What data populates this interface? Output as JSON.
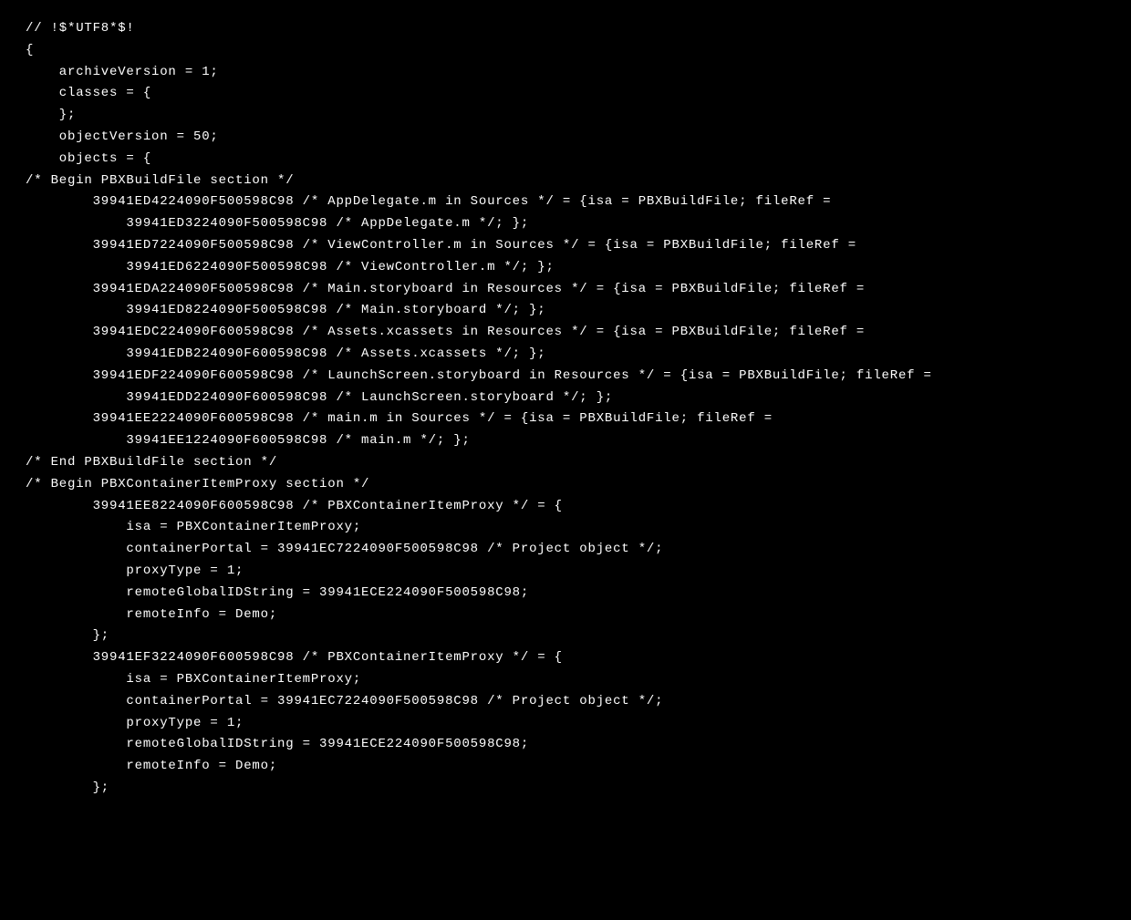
{
  "lines": [
    "// !$*UTF8*$!",
    "{",
    "    archiveVersion = 1;",
    "    classes = {",
    "    };",
    "    objectVersion = 50;",
    "    objects = {",
    "",
    "/* Begin PBXBuildFile section */",
    "        39941ED4224090F500598C98 /* AppDelegate.m in Sources */ = {isa = PBXBuildFile; fileRef =",
    "            39941ED3224090F500598C98 /* AppDelegate.m */; };",
    "        39941ED7224090F500598C98 /* ViewController.m in Sources */ = {isa = PBXBuildFile; fileRef =",
    "            39941ED6224090F500598C98 /* ViewController.m */; };",
    "        39941EDA224090F500598C98 /* Main.storyboard in Resources */ = {isa = PBXBuildFile; fileRef =",
    "            39941ED8224090F500598C98 /* Main.storyboard */; };",
    "        39941EDC224090F600598C98 /* Assets.xcassets in Resources */ = {isa = PBXBuildFile; fileRef =",
    "            39941EDB224090F600598C98 /* Assets.xcassets */; };",
    "        39941EDF224090F600598C98 /* LaunchScreen.storyboard in Resources */ = {isa = PBXBuildFile; fileRef =",
    "            39941EDD224090F600598C98 /* LaunchScreen.storyboard */; };",
    "        39941EE2224090F600598C98 /* main.m in Sources */ = {isa = PBXBuildFile; fileRef =",
    "            39941EE1224090F600598C98 /* main.m */; };",
    "/* End PBXBuildFile section */",
    "",
    "/* Begin PBXContainerItemProxy section */",
    "        39941EE8224090F600598C98 /* PBXContainerItemProxy */ = {",
    "            isa = PBXContainerItemProxy;",
    "            containerPortal = 39941EC7224090F500598C98 /* Project object */;",
    "            proxyType = 1;",
    "            remoteGlobalIDString = 39941ECE224090F500598C98;",
    "            remoteInfo = Demo;",
    "        };",
    "        39941EF3224090F600598C98 /* PBXContainerItemProxy */ = {",
    "            isa = PBXContainerItemProxy;",
    "            containerPortal = 39941EC7224090F500598C98 /* Project object */;",
    "            proxyType = 1;",
    "            remoteGlobalIDString = 39941ECE224090F500598C98;",
    "            remoteInfo = Demo;",
    "        };"
  ]
}
